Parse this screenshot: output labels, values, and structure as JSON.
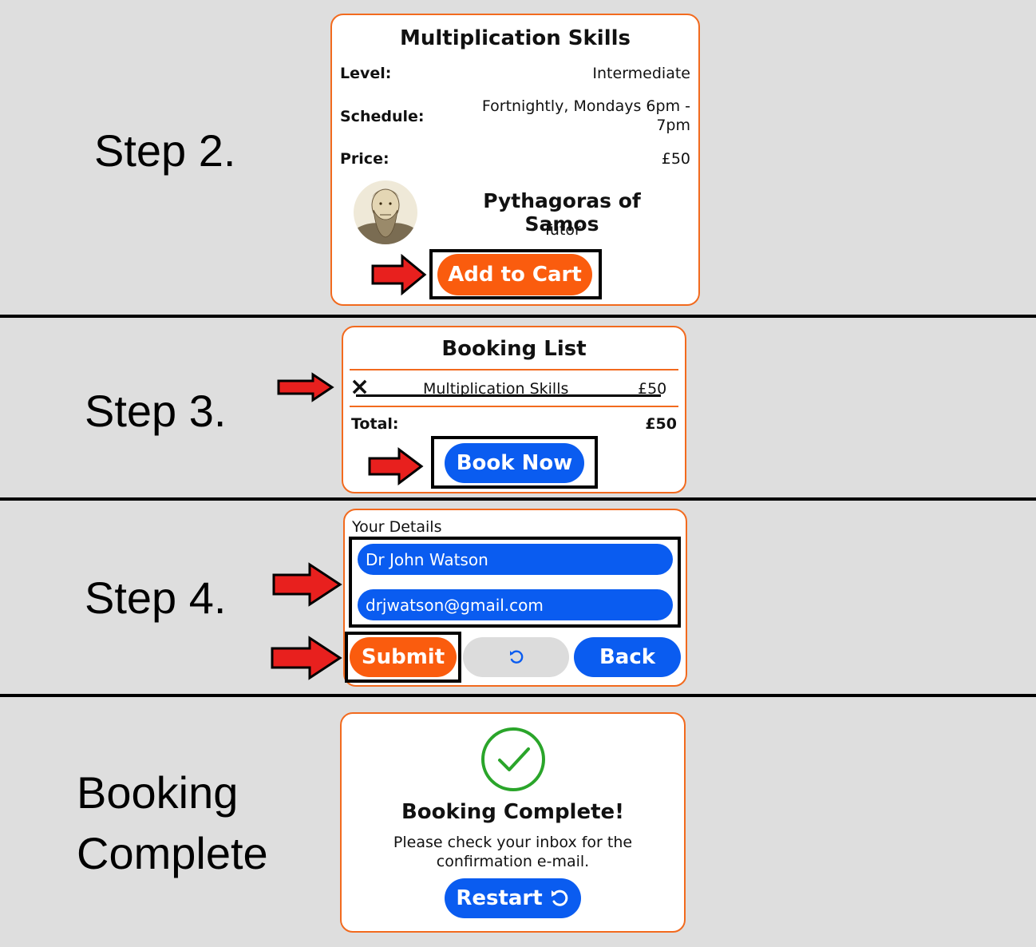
{
  "steps": {
    "step2": "Step 2.",
    "step3": "Step 3.",
    "step4": "Step 4.",
    "complete_line1": "Booking",
    "complete_line2": "Complete"
  },
  "course_card": {
    "title": "Multiplication Skills",
    "rows": [
      {
        "label": "Level:",
        "value": "Intermediate"
      },
      {
        "label": "Schedule:",
        "value_line1": "Fortnightly, Mondays 6pm -",
        "value_line2": "7pm"
      },
      {
        "label": "Price:",
        "value": "£50"
      }
    ],
    "tutor_name": "Pythagoras of Samos",
    "tutor_role": "Tutor",
    "add_to_cart": "Add to Cart"
  },
  "booking_list": {
    "title": "Booking List",
    "remove_icon": "×",
    "item_name": "Multiplication Skills",
    "item_price": "£50",
    "total_label": "Total:",
    "total_value": "£50",
    "book_now": "Book Now"
  },
  "details": {
    "legend": "Your Details",
    "name_value": "Dr John Watson",
    "email_value": "drjwatson@gmail.com",
    "submit": "Submit",
    "reset_icon": "reset-icon",
    "back": "Back"
  },
  "complete": {
    "title": "Booking Complete!",
    "message_line1": "Please check your inbox for the",
    "message_line2": "confirmation e-mail.",
    "restart": "Restart"
  },
  "colors": {
    "accent_orange": "#fa5c0e",
    "accent_blue": "#0a5cf0",
    "success_green": "#2aa52a",
    "arrow_red": "#e8201e"
  }
}
